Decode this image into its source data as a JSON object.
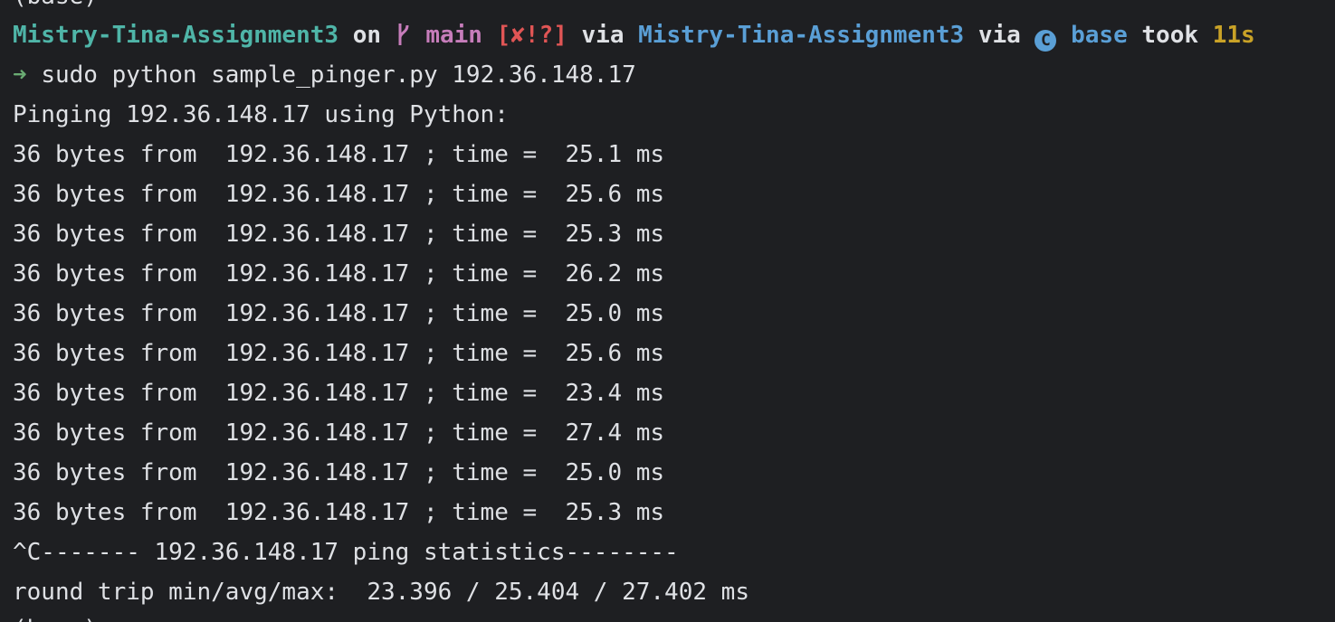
{
  "terminal": {
    "top_partial": "(base)",
    "prompt": {
      "dir": "Mistry-Tina-Assignment3",
      "on": "on",
      "branch": "main",
      "git_status": "[✘!?]",
      "via1": "via",
      "project": "Mistry-Tina-Assignment3",
      "via2": "via",
      "env": "base",
      "took": "took",
      "duration": "11s"
    },
    "command_arrow": "➜",
    "command": "sudo python sample_pinger.py 192.36.148.17",
    "output_header": "Pinging 192.36.148.17 using Python:",
    "ping_lines": [
      "36 bytes from  192.36.148.17 ; time =  25.1 ms",
      "36 bytes from  192.36.148.17 ; time =  25.6 ms",
      "36 bytes from  192.36.148.17 ; time =  25.3 ms",
      "36 bytes from  192.36.148.17 ; time =  26.2 ms",
      "36 bytes from  192.36.148.17 ; time =  25.0 ms",
      "36 bytes from  192.36.148.17 ; time =  25.6 ms",
      "36 bytes from  192.36.148.17 ; time =  23.4 ms",
      "36 bytes from  192.36.148.17 ; time =  27.4 ms",
      "36 bytes from  192.36.148.17 ; time =  25.0 ms",
      "36 bytes from  192.36.148.17 ; time =  25.3 ms"
    ],
    "stats_header": "^C------- 192.36.148.17 ping statistics--------",
    "round_trip": "round trip min/avg/max:  23.396 / 25.404 / 27.402 ms",
    "bottom_partial": "(base)"
  },
  "colors": {
    "background": "#1e1f22",
    "text": "#dfe1e5",
    "repo": "#4fb5a8",
    "branch": "#c77dbb",
    "git_status": "#e05555",
    "project": "#5a9fd6",
    "duration": "#c9a227",
    "arrow": "#6aab73"
  },
  "icons": {
    "branch": "git-branch-icon",
    "conda": "conda-icon"
  }
}
